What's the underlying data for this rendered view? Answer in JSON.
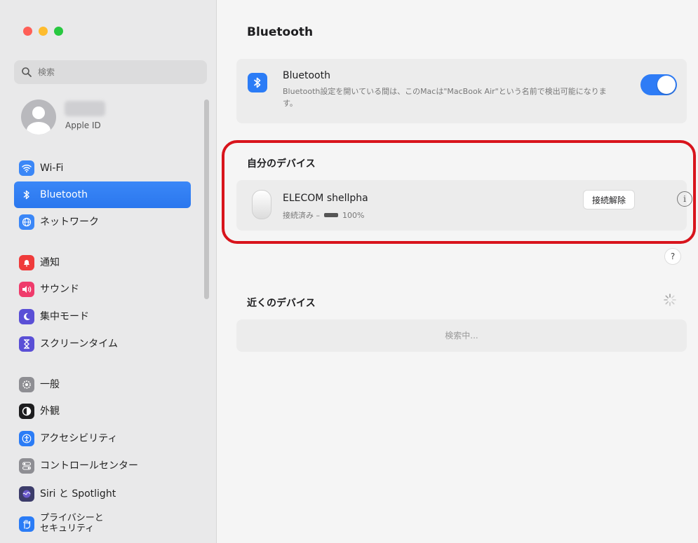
{
  "window": {
    "traffic_colors": [
      "#ff5f57",
      "#febc2e",
      "#28c840"
    ]
  },
  "sidebar": {
    "search_placeholder": "検索",
    "apple_id_label": "Apple ID",
    "items": [
      {
        "label": "Wi-Fi",
        "icon": "wifi-icon",
        "color": "#3b87f7"
      },
      {
        "label": "Bluetooth",
        "icon": "bluetooth-icon",
        "color": "#3b87f7",
        "active": true
      },
      {
        "label": "ネットワーク",
        "icon": "globe-icon",
        "color": "#3b87f7"
      },
      {
        "label": "通知",
        "icon": "bell-icon",
        "color": "#ef3b3b"
      },
      {
        "label": "サウンド",
        "icon": "speaker-icon",
        "color": "#ef3b6b"
      },
      {
        "label": "集中モード",
        "icon": "moon-icon",
        "color": "#5a4fd6"
      },
      {
        "label": "スクリーンタイム",
        "icon": "hourglass-icon",
        "color": "#5a4fd6"
      },
      {
        "label": "一般",
        "icon": "gear-icon",
        "color": "#8e8e93"
      },
      {
        "label": "外観",
        "icon": "appearance-icon",
        "color": "#1d1d1f"
      },
      {
        "label": "アクセシビリティ",
        "icon": "accessibility-icon",
        "color": "#2b7cf6"
      },
      {
        "label": "コントロールセンター",
        "icon": "control-center-icon",
        "color": "#8e8e93"
      },
      {
        "label": "Siri と Spotlight",
        "icon": "siri-icon",
        "color": "#3c3c6a"
      },
      {
        "label": "プライバシーと\nセキュリティ",
        "icon": "hand-icon",
        "color": "#2b7cf6"
      }
    ]
  },
  "main": {
    "title": "Bluetooth",
    "bluetooth_card": {
      "title": "Bluetooth",
      "description": "Bluetooth設定を開いている間は、このMacは\"MacBook Air\"という名前で検出可能になります。",
      "toggle_on": true
    },
    "my_devices": {
      "heading": "自分のデバイス",
      "device_name": "ELECOM shellpha",
      "status_prefix": "接続済み –",
      "battery": "100%",
      "disconnect_label": "接続解除",
      "info_label": "i"
    },
    "help_label": "?",
    "nearby": {
      "heading": "近くのデバイス",
      "searching": "検索中..."
    }
  }
}
